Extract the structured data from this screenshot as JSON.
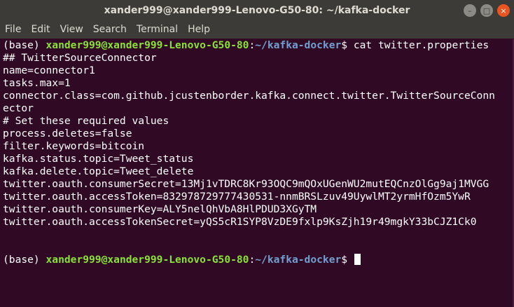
{
  "window": {
    "title": "xander999@xander999-Lenovo-G50-80: ~/kafka-docker",
    "controls": {
      "minimize": "–",
      "maximize": "□",
      "close": "×"
    }
  },
  "menu": [
    "File",
    "Edit",
    "View",
    "Search",
    "Terminal",
    "Help"
  ],
  "terminal": {
    "prompt": {
      "env": "(base) ",
      "user_host": "xander999@xander999-Lenovo-G50-80",
      "sep": ":",
      "path": "~/kafka-docker",
      "dollar": "$ "
    },
    "command": "cat twitter.properties",
    "output": [
      "## TwitterSourceConnector",
      "name=connector1",
      "tasks.max=1",
      "connector.class=com.github.jcustenborder.kafka.connect.twitter.TwitterSourceConn",
      "ector",
      "# Set these required values",
      "process.deletes=false",
      "filter.keywords=bitcoin",
      "kafka.status.topic=Tweet_status",
      "kafka.delete.topic=Tweet_delete",
      "twitter.oauth.consumerSecret=13Mj1vTDRC8Kr93OQC9mQOxUGenWU2mutEQCnzOlGg9aj1MVGG",
      "twitter.oauth.accessToken=832978729777430531-nnmBRSLzuv49UywlMT2yrmHfOzm5YwR",
      "twitter.oauth.consumerKey=ALY5nelQhVbA8HlPDUD3XGyTM",
      "twitter.oauth.accessTokenSecret=yQS5cR1SYP8VzDE9fxlp9KsZjh19r49mgkY33bCJZ1Ck0",
      ""
    ]
  }
}
